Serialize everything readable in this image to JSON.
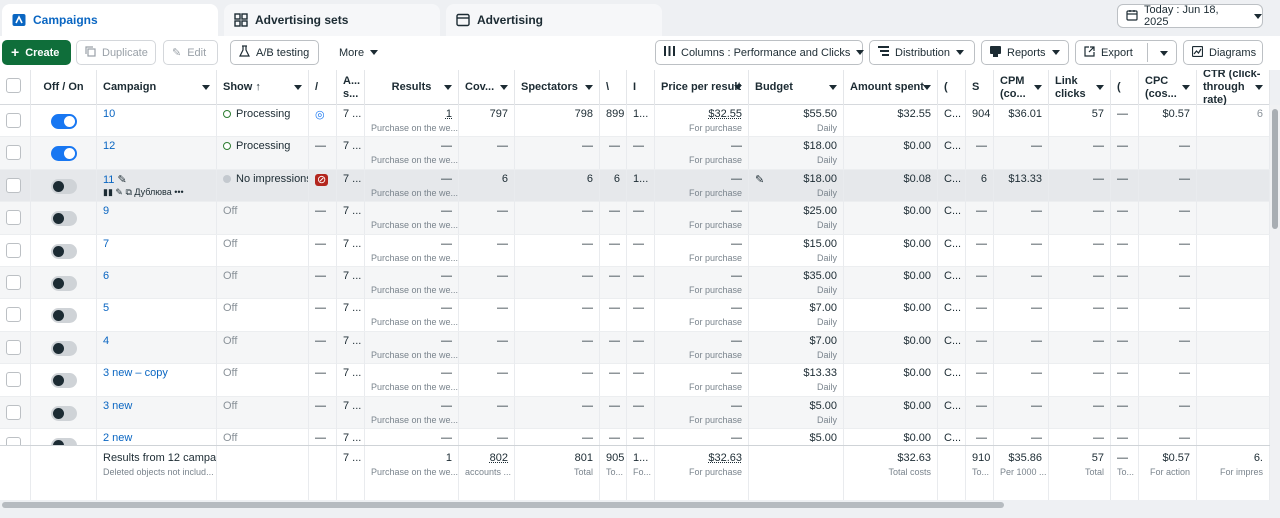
{
  "tabs": [
    {
      "label": "Campaigns",
      "icon": "campaign-icon"
    },
    {
      "label": "Advertising sets",
      "icon": "grid-icon"
    },
    {
      "label": "Advertising",
      "icon": "ad-icon"
    }
  ],
  "date_label": "Today : Jun 18, 2025",
  "toolbar": {
    "create": "Create",
    "duplicate": "Duplicate",
    "edit": "Edit",
    "ab_testing": "A/B testing",
    "more": "More",
    "columns": "Columns : Performance and Clicks",
    "distribution": "Distribution",
    "reports": "Reports",
    "export": "Export",
    "diagrams": "Diagrams"
  },
  "headers": {
    "onoff": "Off / On",
    "campaign": "Campaign",
    "show": "Show ↑",
    "attr": "/",
    "att": "A... s...",
    "results": "Results",
    "coverage": "Cov...",
    "spectators": "Spectators",
    "v": "\\",
    "i": "I",
    "price": "Price per result",
    "budget": "Budget",
    "amount": "Amount spent",
    "c1": "(",
    "s": "S",
    "cpm": "CPM (co...",
    "link": "Link clicks",
    "c2": "(",
    "cpc": "CPC (cos...",
    "ctr": "CTR (click-through rate)"
  },
  "rows": [
    {
      "name": "10",
      "on": true,
      "status": "Processing",
      "st": "proc",
      "attr": "◎",
      "att": "7 ...",
      "results": "1",
      "results_sub": "Purchase on the we...",
      "cov": "797",
      "spect": "798",
      "v": "899",
      "i": "1...",
      "price": "$32.55",
      "price_sub": "For purchase",
      "budget": "$55.50",
      "budget_sub": "Daily",
      "amount": "$32.55",
      "c1": "C...",
      "s": "904",
      "cpm": "$36.01",
      "link": "57",
      "c2": "—",
      "cpc": "$0.57",
      "ctr": "6"
    },
    {
      "name": "12",
      "on": true,
      "status": "Processing",
      "st": "proc",
      "attr": "—",
      "att": "7 ...",
      "results": "—",
      "results_sub": "Purchase on the we...",
      "cov": "—",
      "spect": "—",
      "v": "—",
      "i": "—",
      "price": "—",
      "price_sub": "For purchase",
      "budget": "$18.00",
      "budget_sub": "Daily",
      "amount": "$0.00",
      "c1": "C...",
      "s": "—",
      "cpm": "—",
      "link": "—",
      "c2": "—",
      "cpc": "—",
      "ctr": ""
    },
    {
      "name": "11",
      "on": false,
      "status": "No impressions",
      "st": "noimp",
      "attr": "⊘",
      "att": "7 ...",
      "results": "—",
      "results_sub": "Purchase on the we...",
      "cov": "6",
      "spect": "6",
      "v": "6",
      "i": "1...",
      "price": "—",
      "price_sub": "For purchase",
      "budget": "$18.00",
      "budget_sub": "Daily",
      "amount": "$0.08",
      "c1": "C...",
      "s": "6",
      "cpm": "$13.33",
      "link": "—",
      "c2": "—",
      "cpc": "—",
      "ctr": "",
      "action": "Дублюва"
    },
    {
      "name": "9",
      "on": false,
      "status": "Off",
      "st": "off",
      "attr": "—",
      "att": "7 ...",
      "results": "—",
      "results_sub": "Purchase on the we...",
      "cov": "—",
      "spect": "—",
      "v": "—",
      "i": "—",
      "price": "—",
      "price_sub": "For purchase",
      "budget": "$25.00",
      "budget_sub": "Daily",
      "amount": "$0.00",
      "c1": "C...",
      "s": "—",
      "cpm": "—",
      "link": "—",
      "c2": "—",
      "cpc": "—",
      "ctr": ""
    },
    {
      "name": "7",
      "on": false,
      "status": "Off",
      "st": "off",
      "attr": "—",
      "att": "7 ...",
      "results": "—",
      "results_sub": "Purchase on the we...",
      "cov": "—",
      "spect": "—",
      "v": "—",
      "i": "—",
      "price": "—",
      "price_sub": "For purchase",
      "budget": "$15.00",
      "budget_sub": "Daily",
      "amount": "$0.00",
      "c1": "C...",
      "s": "—",
      "cpm": "—",
      "link": "—",
      "c2": "—",
      "cpc": "—",
      "ctr": ""
    },
    {
      "name": "6",
      "on": false,
      "status": "Off",
      "st": "off",
      "attr": "—",
      "att": "7 ...",
      "results": "—",
      "results_sub": "Purchase on the we...",
      "cov": "—",
      "spect": "—",
      "v": "—",
      "i": "—",
      "price": "—",
      "price_sub": "For purchase",
      "budget": "$35.00",
      "budget_sub": "Daily",
      "amount": "$0.00",
      "c1": "C...",
      "s": "—",
      "cpm": "—",
      "link": "—",
      "c2": "—",
      "cpc": "—",
      "ctr": ""
    },
    {
      "name": "5",
      "on": false,
      "status": "Off",
      "st": "off",
      "attr": "—",
      "att": "7 ...",
      "results": "—",
      "results_sub": "Purchase on the we...",
      "cov": "—",
      "spect": "—",
      "v": "—",
      "i": "—",
      "price": "—",
      "price_sub": "For purchase",
      "budget": "$7.00",
      "budget_sub": "Daily",
      "amount": "$0.00",
      "c1": "C...",
      "s": "—",
      "cpm": "—",
      "link": "—",
      "c2": "—",
      "cpc": "—",
      "ctr": ""
    },
    {
      "name": "4",
      "on": false,
      "status": "Off",
      "st": "off",
      "attr": "—",
      "att": "7 ...",
      "results": "—",
      "results_sub": "Purchase on the we...",
      "cov": "—",
      "spect": "—",
      "v": "—",
      "i": "—",
      "price": "—",
      "price_sub": "For purchase",
      "budget": "$7.00",
      "budget_sub": "Daily",
      "amount": "$0.00",
      "c1": "C...",
      "s": "—",
      "cpm": "—",
      "link": "—",
      "c2": "—",
      "cpc": "—",
      "ctr": ""
    },
    {
      "name": "3 new – copy",
      "on": false,
      "status": "Off",
      "st": "off",
      "attr": "—",
      "att": "7 ...",
      "results": "—",
      "results_sub": "Purchase on the we...",
      "cov": "—",
      "spect": "—",
      "v": "—",
      "i": "—",
      "price": "—",
      "price_sub": "For purchase",
      "budget": "$13.33",
      "budget_sub": "Daily",
      "amount": "$0.00",
      "c1": "C...",
      "s": "—",
      "cpm": "—",
      "link": "—",
      "c2": "—",
      "cpc": "—",
      "ctr": ""
    },
    {
      "name": "3 new",
      "on": false,
      "status": "Off",
      "st": "off",
      "attr": "—",
      "att": "7 ...",
      "results": "—",
      "results_sub": "Purchase on the we...",
      "cov": "—",
      "spect": "—",
      "v": "—",
      "i": "—",
      "price": "—",
      "price_sub": "For purchase",
      "budget": "$5.00",
      "budget_sub": "Daily",
      "amount": "$0.00",
      "c1": "C...",
      "s": "—",
      "cpm": "—",
      "link": "—",
      "c2": "—",
      "cpc": "—",
      "ctr": ""
    },
    {
      "name": "2 new",
      "on": false,
      "status": "Off",
      "st": "off",
      "attr": "—",
      "att": "7 ...",
      "results": "—",
      "results_sub": "",
      "cov": "—",
      "spect": "—",
      "v": "—",
      "i": "—",
      "price": "—",
      "price_sub": "",
      "budget": "$5.00",
      "budget_sub": "",
      "amount": "$0.00",
      "c1": "C...",
      "s": "—",
      "cpm": "—",
      "link": "—",
      "c2": "—",
      "cpc": "—",
      "ctr": ""
    }
  ],
  "footer": {
    "campaign": "Results from 12 campaig",
    "campaign_sub": "Deleted objects not includ...",
    "att": "7 ...",
    "results": "1",
    "results_sub": "Purchase on the we...",
    "cov": "802",
    "cov_sub": "accounts ...",
    "spect": "801",
    "spect_sub": "Total",
    "v": "905",
    "v_sub": "To...",
    "i": "1...",
    "i_sub": "Fo...",
    "price": "$32.63",
    "price_sub": "For purchase",
    "amount": "$32.63",
    "amount_sub": "Total costs",
    "s": "910",
    "s_sub": "To...",
    "cpm": "$35.86",
    "cpm_sub": "Per 1000 ...",
    "link": "57",
    "link_sub": "Total",
    "c2": "—",
    "c2_sub": "To...",
    "cpc": "$0.57",
    "cpc_sub": "For action",
    "ctr": "6.",
    "ctr_sub": "For impres"
  }
}
